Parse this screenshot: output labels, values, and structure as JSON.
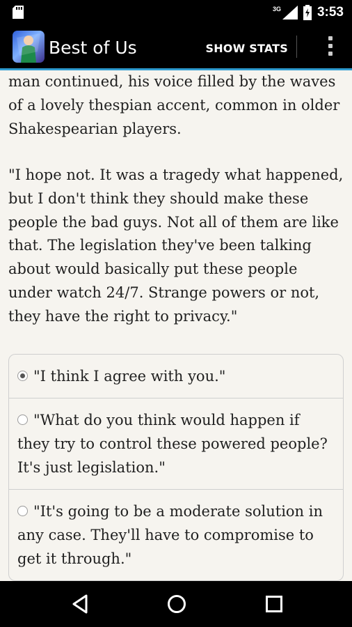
{
  "status_bar": {
    "time": "3:53",
    "network": "3G",
    "icons": [
      "sd-card-icon",
      "signal-icon",
      "battery-icon"
    ]
  },
  "app_bar": {
    "title": "Best of Us",
    "show_stats_label": "SHOW STATS",
    "icons": [
      "app-icon",
      "overflow-menu-icon"
    ],
    "accent_color": "#2f9cd0"
  },
  "story": {
    "paragraphs": [
      "man continued, his voice filled by the waves of a lovely thespian accent, common in older Shakespearian players.",
      "\"I hope not. It was a tragedy what happened, but I don't think they should make these people the bad guys. Not all of them are like that. The legislation they've been talking about would basically put these people under watch 24/7. Strange powers or not, they have the right to privacy.\""
    ]
  },
  "choices": [
    {
      "text": "\"I think I agree with you.\"",
      "selected": true
    },
    {
      "text": "\"What do you think would happen if they try to control these powered people? It's just legislation.\"",
      "selected": false
    },
    {
      "text": "\"It's going to be a moderate solution in any case. They'll have to compromise to get it through.\"",
      "selected": false
    }
  ],
  "nav_bar": {
    "icons": [
      "back-icon",
      "home-icon",
      "recents-icon"
    ]
  }
}
